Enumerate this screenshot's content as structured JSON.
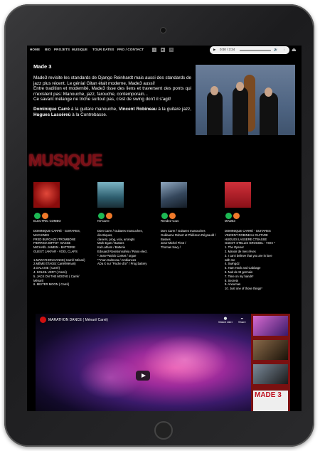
{
  "nav": {
    "items": [
      "HOME",
      "BIO",
      "PROJETS",
      "MUSIQUE",
      "TOUR DATES",
      "PRO / CONTACT"
    ],
    "social_icons": [
      "facebook-icon",
      "youtube-icon",
      "email-icon"
    ]
  },
  "player": {
    "time": "0:00 / 3:24",
    "play_icon": "play-icon",
    "volume_icon": "volume-icon",
    "menu_icon": "more-icon"
  },
  "intro": {
    "title": "Made 3",
    "p1": "Made3 revisite les standards de Django Reinhardt mais aussi des standards de jazz plus récent. Le génial Gitan était moderne, Made3 aussi!",
    "p2": "Entre tradition et modernité, Made3 tisse des liens et traversent des ponts qui n'existent pas: Manouche, jazz, farouche, contemporain...",
    "p3": "Ce savant mélange ne triche surtout pas, c'est de swing don't il s'agit!",
    "p4_a": "Dominique Carré",
    "p4_b": " à la guitare manouche, ",
    "p4_c": "Vincent Robineau",
    "p4_d": " à la guitare jazz, ",
    "p4_e": "Hugues Lasséreù",
    "p4_f": " à la Contrebasse."
  },
  "musique_heading": "MUSIQUE",
  "albums": [
    {
      "title": "ELECTRIC COMBO",
      "cover": "#b81616",
      "tracks": [
        "DOMINIQUE CARRÉ - GUITARES,",
        "MACHINES",
        "FRED BURGAZZI-TROMBONE",
        "PIERRICK BIFFOT -BASSE",
        "MICHAËL JAMEIN - BATTERIE",
        "GUEST: JAKFAR - VOIX, CLAPS",
        "",
        "1.MARATHON DANCE( Carré/ Ménari)",
        "2.MÊME ÉTAGE( Carré/Ménari)",
        "3.GALAXIE ( Carré)",
        "4. SOLEIL VERT ( Carré)",
        "5. JACK ON THE MOOVE ( Carré/",
        "Ménari)",
        "6. MISTER MOON ( Carré)"
      ]
    },
    {
      "title": "NYCarre",
      "cover": "#3b7f8f",
      "tracks": [
        "Dom Carre / Guitares manouches,",
        "électriques,",
        "claviers, prog, voix, arrangts",
        "Mark Egan / Basses",
        "Kal Latham / Batterie",
        "Edouard Rosebonnafeia / Piano elect.",
        "* Jean-Patrick Cosset / orgue",
        "**Yvan Salmona / Ambiances",
        "ADa X sur \"Pache d'or\" / Prog battery"
      ]
    },
    {
      "title": "Rendez-vous",
      "cover": "#5a6e86",
      "tracks": [
        "Dom Carre / Guitares manouches",
        "Guillaume Robert et Philémon Régnauld /",
        "Basses",
        "Jean-Michel Pivot /",
        "Thomas Savy /"
      ]
    },
    {
      "title": "MADE3",
      "cover": "#c4232c",
      "tracks": [
        "DOMINIQUE CARRÉ - GUITARES",
        "VINCENT ROBINEAU GUITARE",
        "HUGUES LASSERE CTBASSE",
        "GUEST: STELLIS GROSSEL - VOIX *",
        "1. The Opener",
        "2. Manoir de mes rêves",
        "3. I can't believe that you are in love",
        "with me",
        "4. Swing42",
        "5. Ham Hock and Cabbage",
        "6. Nuit de St germain",
        "7. Time on my hands*",
        "8. Secrets",
        "9. Anouman",
        "10. Just one of those things*"
      ]
    }
  ],
  "video": {
    "title": "MARATHON DANCE ( Ménari/ Carré)",
    "watch_later": "Watch later",
    "share": "Share",
    "thumb_label": "MADE 3"
  },
  "colors": {
    "heading": "#7a1016",
    "spotify": "#1db954",
    "apple": "#f07a2a"
  }
}
